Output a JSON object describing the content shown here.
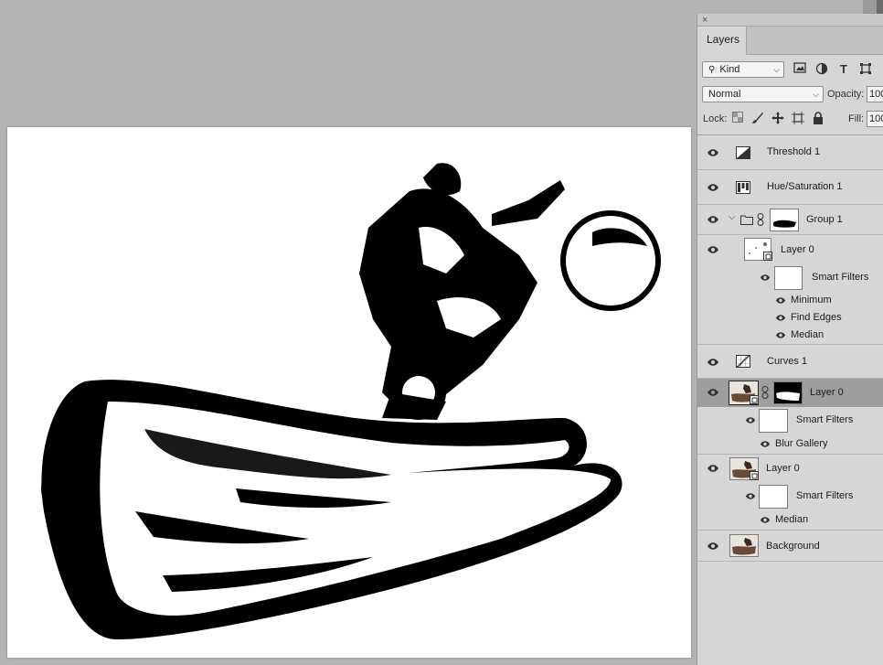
{
  "panel": {
    "close_glyph": "×",
    "tab": "Layers",
    "filter": {
      "kind_label": "Kind",
      "kind_icon": "search-icon"
    },
    "blend": {
      "mode": "Normal",
      "opacity_label": "Opacity:",
      "opacity_value": "100"
    },
    "lock": {
      "label": "Lock:",
      "fill_label": "Fill:",
      "fill_value": "100"
    }
  },
  "layers": [
    {
      "name": "Threshold 1",
      "type": "adjustment-threshold"
    },
    {
      "name": "Hue/Saturation 1",
      "type": "adjustment-hue"
    },
    {
      "name": "Group 1",
      "type": "group"
    },
    {
      "name": "Layer 0",
      "type": "smart-object",
      "sub": {
        "title": "Smart Filters",
        "filters": [
          "Minimum",
          "Find Edges",
          "Median"
        ]
      }
    },
    {
      "name": "Curves 1",
      "type": "adjustment-curves"
    },
    {
      "name": "Layer 0",
      "type": "smart-object-masked",
      "selected": true,
      "sub": {
        "title": "Smart Filters",
        "filters": [
          "Blur Gallery"
        ]
      }
    },
    {
      "name": "Layer 0",
      "type": "smart-object",
      "sub": {
        "title": "Smart Filters",
        "filters": [
          "Median"
        ]
      }
    },
    {
      "name": "Background",
      "type": "background"
    }
  ],
  "colors": {
    "panel_bg": "#d6d6d6",
    "selected_row": "#9e9e9e",
    "canvas_bg": "#b4b4b4"
  }
}
